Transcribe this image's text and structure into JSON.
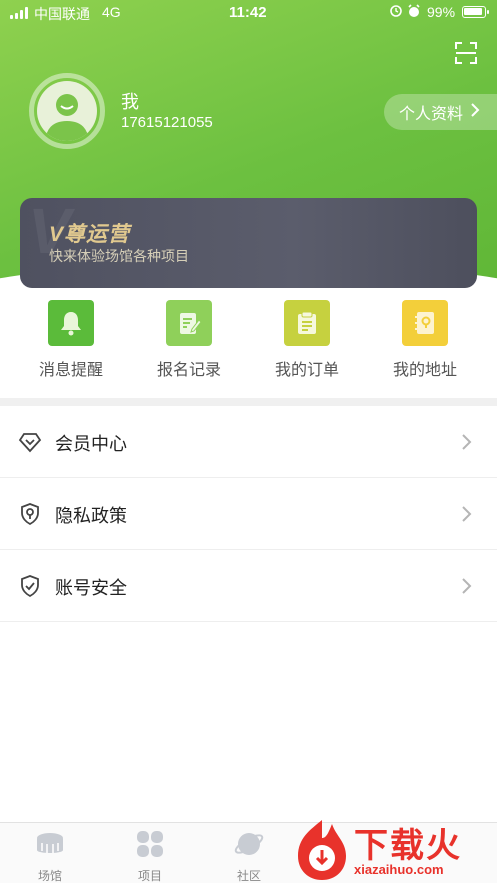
{
  "status_bar": {
    "carrier": "中国联通",
    "network": "4G",
    "time": "11:42",
    "battery_percent": "99%"
  },
  "profile": {
    "name": "我",
    "phone": "17615121055",
    "profile_button_label": "个人资料"
  },
  "vip_card": {
    "title": "V尊运营",
    "subtitle": "快来体验场馆各种项目"
  },
  "quick_actions": [
    {
      "label": "消息提醒",
      "icon": "bell-icon",
      "color": "#5bbb3a"
    },
    {
      "label": "报名记录",
      "icon": "edit-note-icon",
      "color": "#8fd05a"
    },
    {
      "label": "我的订单",
      "icon": "clipboard-icon",
      "color": "#c6d13f"
    },
    {
      "label": "我的地址",
      "icon": "address-book-icon",
      "color": "#f3cf3a"
    }
  ],
  "menu_items": [
    {
      "label": "会员中心",
      "icon": "diamond-icon"
    },
    {
      "label": "隐私政策",
      "icon": "location-shield-icon"
    },
    {
      "label": "账号安全",
      "icon": "shield-check-icon"
    }
  ],
  "tab_bar": [
    {
      "label": "场馆",
      "icon": "stadium-icon"
    },
    {
      "label": "项目",
      "icon": "grid-icon"
    },
    {
      "label": "社区",
      "icon": "planet-icon"
    }
  ],
  "watermark": {
    "text": "下载火",
    "url": "xiazaihuo.com"
  },
  "colors": {
    "header_green": "#6cc040",
    "vip_gold": "#e1c98f",
    "vip_dark": "#525462",
    "tab_inactive": "#c8ccd3"
  }
}
